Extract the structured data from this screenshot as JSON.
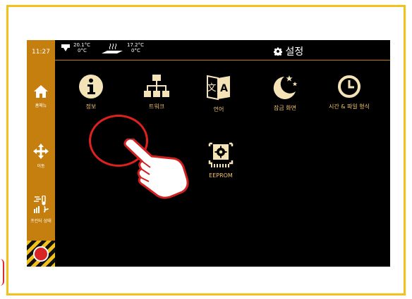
{
  "status": {
    "time": "11:27",
    "nozzle_temp": "20.1°C",
    "nozzle_target": "0°C",
    "bed_temp": "17.2°C",
    "bed_target": "0°C"
  },
  "header": {
    "title": "설정",
    "icon": "gear-icon"
  },
  "sidebar": {
    "home_label": "홈메뉴",
    "move_label": "이동",
    "status_label": "프린터 상태"
  },
  "settings": {
    "info_label": "정보",
    "network_label": "트워크",
    "language_label": "언어",
    "sleep_label": "잠금 화면",
    "time_label": "시간 & 파일 형식",
    "eeprom_label": "EEPROM"
  },
  "colors": {
    "accent": "#c47f0e",
    "frame": "#f2c21b",
    "label": "#f0c36a",
    "callout": "#e02020"
  }
}
